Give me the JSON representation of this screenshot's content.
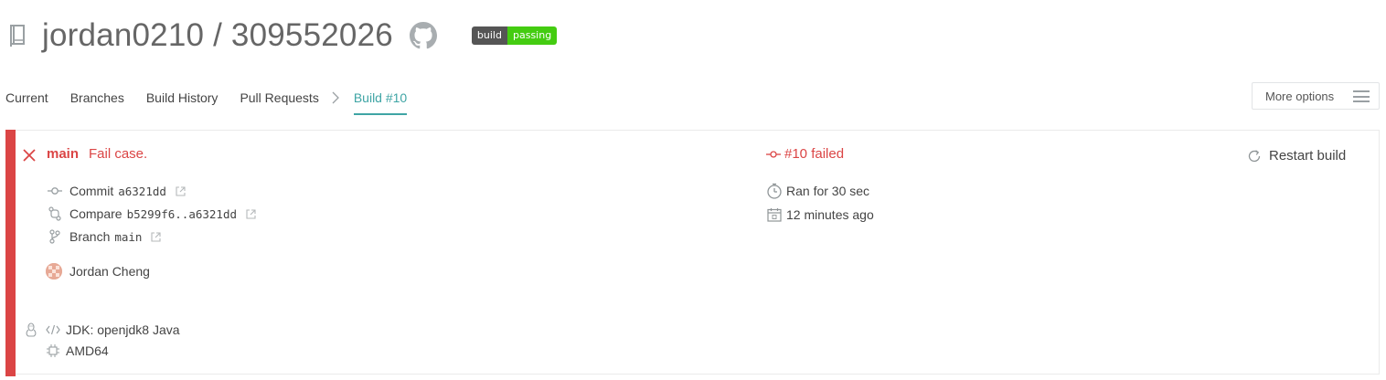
{
  "header": {
    "repo_title": "jordan0210 / 309552026",
    "badge": {
      "left": "build",
      "right": "passing"
    }
  },
  "nav": {
    "tabs": [
      {
        "label": "Current"
      },
      {
        "label": "Branches"
      },
      {
        "label": "Build History"
      },
      {
        "label": "Pull Requests"
      }
    ],
    "active_tab": "Build #10",
    "more_options": "More options"
  },
  "build": {
    "branch": "main",
    "message": "Fail case.",
    "status_text": "#10 failed",
    "restart_label": "Restart build",
    "commit": {
      "label": "Commit",
      "value": "a6321dd"
    },
    "compare": {
      "label": "Compare",
      "value": "b5299f6..a6321dd"
    },
    "branch_row": {
      "label": "Branch",
      "value": "main"
    },
    "author": "Jordan Cheng",
    "duration": "Ran for 30 sec",
    "finished": "12 minutes ago",
    "jdk": "JDK: openjdk8 Java",
    "arch": "AMD64"
  },
  "colors": {
    "failed": "#db4545",
    "accent": "#3fa5a5",
    "badge_pass": "#44cc11"
  }
}
